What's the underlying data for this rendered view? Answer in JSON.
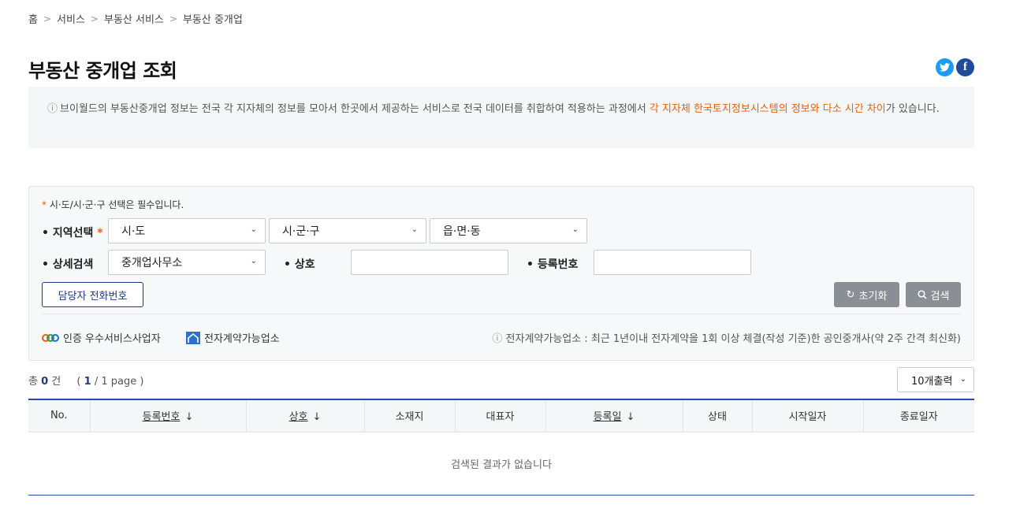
{
  "breadcrumb": {
    "home": "홈",
    "level1": "서비스",
    "level2": "부동산 서비스",
    "level3": "부동산 중개업"
  },
  "page_title": "부동산 중개업 조회",
  "share": {
    "twitter_icon": "twitter-icon",
    "facebook_icon": "facebook-icon",
    "facebook_glyph": "f"
  },
  "notice": {
    "text": "브이월드의 부동산중개업 정보는 전국 각 지자체의 정보를 모아서 한곳에서 제공하는 서비스로 전국 데이터를 취합하여 적용하는 과정에서 ",
    "highlight": "각 지자체 한국토지정보시스템의 정보와 다소 시간 차이",
    "tail": "가 있습니다."
  },
  "search": {
    "required_note": "시·도/시·군·구 선택은 필수입니다.",
    "region_label": "• 지역선택",
    "sido": "시·도",
    "sigungu": "시·군·구",
    "eupmyeondong": "읍·면·동",
    "detail_label": "• 상세검색",
    "detail_select": "중개업사무소",
    "name_label": "• 상호",
    "name_value": "",
    "regno_label": "• 등록번호",
    "regno_value": "",
    "phone_button": "담당자 전화번호",
    "reset_button": "초기화",
    "search_button": "검색"
  },
  "legend": {
    "certified": "인증 우수서비스사업자",
    "econtract": "전자계약가능업소",
    "note": "전자계약가능업소 : 최근 1년이내 전자계약을 1회 이상 체결(작성 기준)한 공인중개사(약 2주 간격 최신화)"
  },
  "results": {
    "total_prefix": "총",
    "total_count": "0",
    "total_suffix": "건",
    "page_open": "(",
    "page_current": "1",
    "page_rest": "/ 1 page",
    "page_close": ")",
    "per_page": "10개출력",
    "columns": [
      "No.",
      "등록번호",
      "상호",
      "소재지",
      "대표자",
      "등록일",
      "상태",
      "시작일자",
      "종료일자"
    ],
    "empty": "검색된 결과가 없습니다"
  }
}
